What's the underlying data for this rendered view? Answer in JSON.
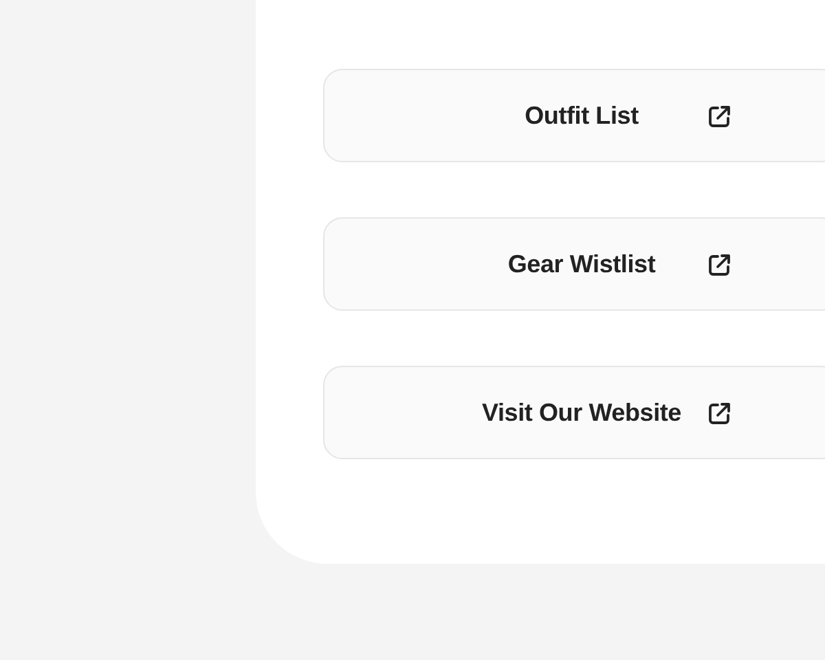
{
  "links": [
    {
      "label": "Outfit List"
    },
    {
      "label": "Gear Wistlist"
    },
    {
      "label": "Visit Our Website"
    }
  ]
}
